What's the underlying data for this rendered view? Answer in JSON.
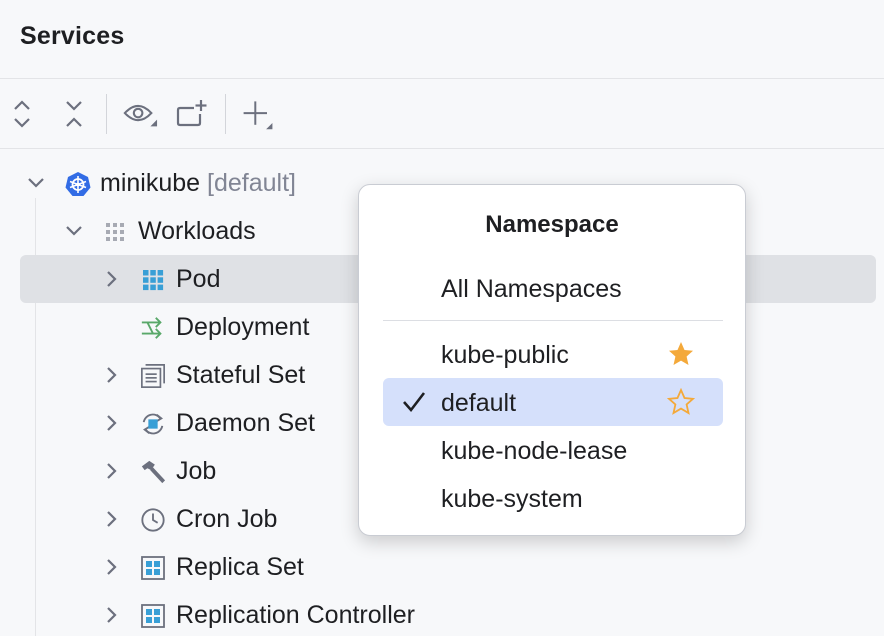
{
  "header": {
    "title": "Services"
  },
  "toolbar": {
    "buttons": [
      {
        "name": "expand-all",
        "icon": "expand-all-icon"
      },
      {
        "name": "collapse-all",
        "icon": "collapse-all-icon"
      },
      {
        "name": "view-options",
        "icon": "eye-icon"
      },
      {
        "name": "new-tab",
        "icon": "add-tab-icon"
      },
      {
        "name": "add-service",
        "icon": "plus-icon"
      }
    ]
  },
  "tree": {
    "root": {
      "name": "minikube",
      "namespace": "[default]",
      "icon": "kubernetes-icon"
    },
    "workloads": {
      "label": "Workloads",
      "icon": "grid-icon"
    },
    "items": [
      {
        "label": "Pod",
        "icon": "pod-icon",
        "expandable": true,
        "selected": true
      },
      {
        "label": "Deployment",
        "icon": "deployment-icon",
        "expandable": false
      },
      {
        "label": "Stateful Set",
        "icon": "stateful-set-icon",
        "expandable": true
      },
      {
        "label": "Daemon Set",
        "icon": "daemon-set-icon",
        "expandable": true
      },
      {
        "label": "Job",
        "icon": "hammer-icon",
        "expandable": true
      },
      {
        "label": "Cron Job",
        "icon": "clock-icon",
        "expandable": true
      },
      {
        "label": "Replica Set",
        "icon": "replica-set-icon",
        "expandable": true
      },
      {
        "label": "Replication Controller",
        "icon": "replication-controller-icon",
        "expandable": true
      }
    ]
  },
  "popup": {
    "title": "Namespace",
    "all_label": "All Namespaces",
    "namespaces": [
      {
        "label": "kube-public",
        "favorite": true,
        "selected": false
      },
      {
        "label": "default",
        "favorite": false,
        "selected": true
      },
      {
        "label": "kube-node-lease",
        "favorite": false,
        "selected": false
      },
      {
        "label": "kube-system",
        "favorite": false,
        "selected": false
      }
    ]
  },
  "colors": {
    "kubernetes_blue": "#326ce5",
    "icon_blue": "#389fd6",
    "deployment_green": "#59a869",
    "star_orange": "#f4a93a",
    "selection_bg": "#dfe1e5",
    "popup_active_bg": "#d5e0fb"
  }
}
